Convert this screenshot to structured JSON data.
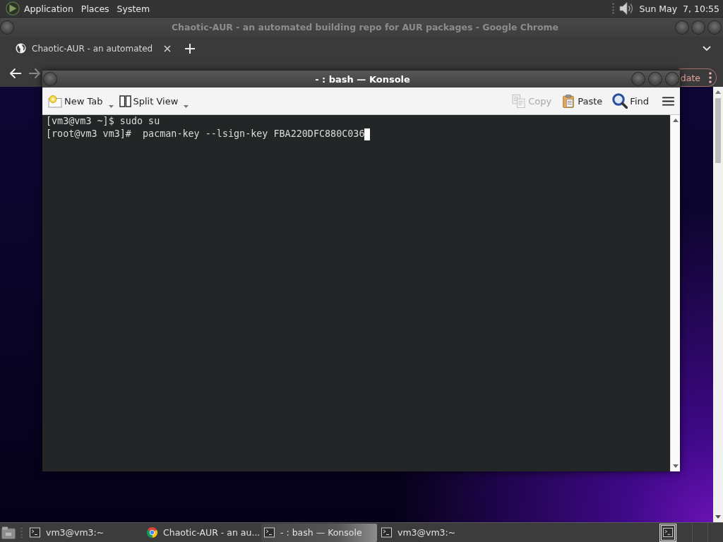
{
  "top_panel": {
    "menus": [
      "Application",
      "Places",
      "System"
    ],
    "clock": "Sun May  7, 10:55"
  },
  "browser": {
    "title": "Chaotic-AUR - an automated building repo for AUR packages - Google Chrome",
    "tabs": [
      {
        "label": "Chaotic-AUR - an automated"
      }
    ],
    "nav": {
      "back": {
        "disabled": false
      },
      "forward": {
        "disabled": true
      }
    },
    "update_button": {
      "label": "date"
    }
  },
  "konsole": {
    "title": "- : bash — Konsole",
    "toolbar_left": [
      {
        "kind": "newtab",
        "label": "New Tab",
        "dropdown": true,
        "disabled": false
      },
      {
        "kind": "split",
        "label": "Split View",
        "dropdown": true,
        "disabled": false
      }
    ],
    "toolbar_right": [
      {
        "kind": "copy",
        "label": "Copy",
        "dropdown": false,
        "disabled": true
      },
      {
        "kind": "paste",
        "label": "Paste",
        "dropdown": false,
        "disabled": false
      },
      {
        "kind": "find",
        "label": "Find",
        "dropdown": false,
        "disabled": false
      }
    ],
    "lines": [
      "[vm3@vm3 ~]$ sudo su",
      "[root@vm3 vm3]#  pacman-key --lsign-key FBA220DFC880C036"
    ]
  },
  "taskbar": {
    "items": [
      {
        "kind": "terminal",
        "label": "vm3@vm3:~",
        "selected": false
      },
      {
        "kind": "browser",
        "label": "Chaotic-AUR - an au...",
        "selected": false
      },
      {
        "kind": "terminal",
        "label": "- : bash — Konsole",
        "selected": true
      },
      {
        "kind": "terminal",
        "label": "vm3@vm3:~",
        "selected": false
      }
    ],
    "workspaces": [
      {
        "selected": true,
        "occupied": true
      },
      {
        "selected": false,
        "occupied": false
      },
      {
        "selected": false,
        "occupied": false
      },
      {
        "selected": false,
        "occupied": false
      }
    ]
  }
}
